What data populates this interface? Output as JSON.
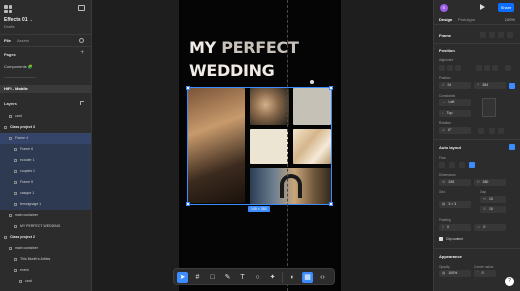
{
  "file": {
    "name": "Effects 01",
    "chevron": "⌄",
    "sub": "Drafts"
  },
  "left_tabs": {
    "file": "File",
    "assets": "Assets"
  },
  "pages": {
    "title": "Pages",
    "items": [
      {
        "label": "Components 🧩",
        "state": "normal"
      },
      {
        "label": "————————",
        "state": "dim"
      },
      {
        "label": "HiFi - Mobile",
        "state": "selected"
      }
    ]
  },
  "layers": {
    "title": "Layers",
    "items": [
      {
        "label": "card",
        "indent": 1,
        "state": "normal"
      },
      {
        "label": "Class project 3",
        "indent": 0,
        "state": "bold"
      },
      {
        "label": "Frame 4",
        "indent": 1,
        "state": "hl2"
      },
      {
        "label": "Frame 6",
        "indent": 2,
        "state": "hl"
      },
      {
        "label": "ecouter 1",
        "indent": 2,
        "state": "hl"
      },
      {
        "label": "couples 1",
        "indent": 2,
        "state": "hl"
      },
      {
        "label": "Frame 5",
        "indent": 2,
        "state": "hl"
      },
      {
        "label": "casque 1",
        "indent": 2,
        "state": "hl"
      },
      {
        "label": "temoignage 1",
        "indent": 2,
        "state": "hl"
      },
      {
        "label": "main container",
        "indent": 1,
        "state": "normal"
      },
      {
        "label": "MY PERFECT WEDDING",
        "indent": 2,
        "state": "normal"
      },
      {
        "label": "Class project 2",
        "indent": 0,
        "state": "bold"
      },
      {
        "label": "main container",
        "indent": 1,
        "state": "normal"
      },
      {
        "label": "This Month's Artists",
        "indent": 2,
        "state": "normal"
      },
      {
        "label": "event",
        "indent": 2,
        "state": "normal"
      },
      {
        "label": "card",
        "indent": 3,
        "state": "normal"
      }
    ]
  },
  "canvas": {
    "title_line1a": "MY",
    "title_line1b": "PERFECT",
    "title_line2": "WEDDING",
    "dimension_badge": "145 × 280"
  },
  "toolbar": {
    "tools": [
      "move-tool",
      "frame-tool",
      "shape-tool",
      "pen-tool",
      "text-tool",
      "comment-tool",
      "actions-tool",
      "dev-mode-tool",
      "code-tool"
    ]
  },
  "right": {
    "avatar_letter": "E",
    "share_label": "Share",
    "tab_design": "Design",
    "tab_prototype": "Prototype",
    "zoom": "100%",
    "frame_label": "Frame",
    "position_title": "Position",
    "alignment_label": "Alignment",
    "position_label": "Position",
    "x_prefix": "X",
    "x_value": "24",
    "y_prefix": "Y",
    "y_value": "284",
    "constraints_label": "Constraints",
    "constraint_h": "Left",
    "constraint_v": "Top",
    "rotation_label": "Rotation",
    "rotation_value": "0°",
    "autolayout_title": "Auto layout",
    "flow_label": "Flow",
    "dimensions_label": "Dimensions",
    "w_prefix": "W",
    "w_value": "245",
    "h_prefix": "H",
    "h_value": "280",
    "grid_label": "Grid",
    "gap_label": "Gap",
    "grid_value": "3 × 3",
    "gap_value": "10",
    "gap_value2": "10",
    "padding_label": "Padding",
    "pad_value1": "0",
    "pad_value2": "0",
    "clip_label": "Clip content",
    "appearance_title": "Appearance",
    "opacity_label": "Opacity",
    "opacity_value": "100%",
    "radius_label": "Corner radius",
    "radius_value": "0",
    "help_label": "?"
  }
}
